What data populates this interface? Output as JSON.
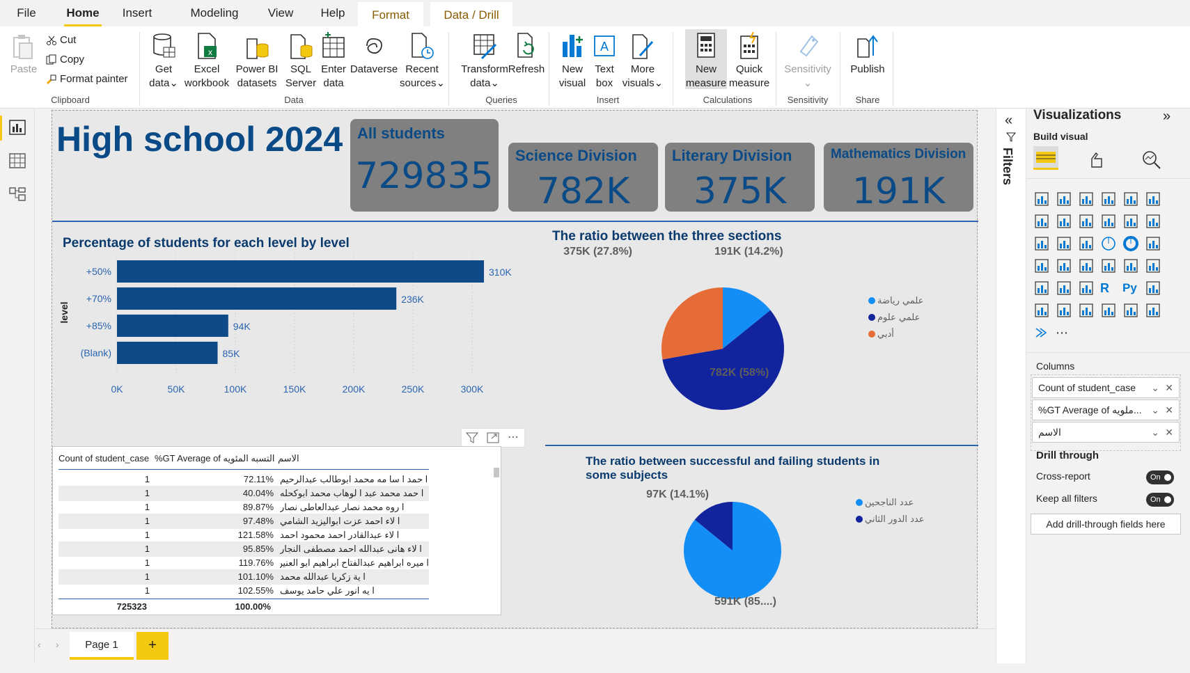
{
  "menu": {
    "items": [
      "File",
      "Home",
      "Insert",
      "Modeling",
      "View",
      "Help"
    ],
    "context_tabs": [
      "Format",
      "Data / Drill"
    ],
    "active": "Home"
  },
  "ribbon": {
    "clipboard": {
      "paste": "Paste",
      "cut": "Cut",
      "copy": "Copy",
      "format_painter": "Format painter",
      "group": "Clipboard"
    },
    "data": {
      "get_data": [
        "Get",
        "data"
      ],
      "excel": [
        "Excel",
        "workbook"
      ],
      "powerbi": [
        "Power BI",
        "datasets"
      ],
      "sql": [
        "SQL",
        "Server"
      ],
      "enter": [
        "Enter",
        "data"
      ],
      "dataverse": "Dataverse",
      "recent": [
        "Recent",
        "sources"
      ],
      "group": "Data"
    },
    "queries": {
      "transform": [
        "Transform",
        "data"
      ],
      "refresh": "Refresh",
      "group": "Queries"
    },
    "insert": {
      "new_visual": [
        "New",
        "visual"
      ],
      "text_box": [
        "Text",
        "box"
      ],
      "more_visuals": [
        "More",
        "visuals"
      ],
      "group": "Insert"
    },
    "calculations": {
      "new_measure": [
        "New",
        "measure"
      ],
      "quick_measure": [
        "Quick",
        "measure"
      ],
      "group": "Calculations"
    },
    "sensitivity": {
      "label": "Sensitivity",
      "group": "Sensitivity"
    },
    "share": {
      "publish": "Publish",
      "group": "Share"
    }
  },
  "report": {
    "title": "High school 2024",
    "cards": [
      {
        "title": "All students",
        "value": "729835"
      },
      {
        "title": "Science Division",
        "value": "782K"
      },
      {
        "title": "Literary Division",
        "value": "375K"
      },
      {
        "title": "Mathematics Division",
        "value": "191K"
      }
    ],
    "bar_title": "Percentage of students for each level by level",
    "pie1_title": "The ratio between the three sections",
    "pie2_title": "The ratio between successful and failing students in some subjects",
    "table": {
      "headers": [
        "Count of student_case",
        "%GT Average of التسبه المئويه",
        "الاسم"
      ],
      "rows": [
        [
          "1",
          "72.11%",
          "ا حمد ا سا مه محمد ابوطالب عبدالرحيم"
        ],
        [
          "1",
          "40.04%",
          "ا حمد محمد عبد ا لوهاب محمد ابوكحله"
        ],
        [
          "1",
          "89.87%",
          "ا روه محمد نصار عبدالعاطى نصار"
        ],
        [
          "1",
          "97.48%",
          "ا لاء احمد عزت ابواليزيد الشامي"
        ],
        [
          "1",
          "121.58%",
          "ا لاء عبدالقادر احمد محمود احمد"
        ],
        [
          "1",
          "95.85%",
          "ا لاء هانى عبدالله احمد مصطفى النجار"
        ],
        [
          "1",
          "119.76%",
          "ا ميره ابراهيم عبدالفتاح ابراهيم ابو العنين"
        ],
        [
          "1",
          "101.10%",
          "ا ية زكريا عبدالله محمد"
        ],
        [
          "1",
          "102.55%",
          "ا يه انور علي حامد يوسف"
        ]
      ],
      "total": [
        "725323",
        "100.00%"
      ]
    }
  },
  "chart_data": [
    {
      "type": "bar",
      "orientation": "horizontal",
      "title": "Percentage of students for each level by level",
      "ylabel": "level",
      "categories": [
        "+50%",
        "+70%",
        "+85%",
        "(Blank)"
      ],
      "values": [
        310000,
        236000,
        94000,
        85000
      ],
      "data_labels": [
        "310K",
        "236K",
        "94K",
        "85K"
      ],
      "xticks": [
        "0K",
        "50K",
        "100K",
        "150K",
        "200K",
        "250K",
        "300K"
      ],
      "xlim": [
        0,
        300000
      ],
      "color": "#0d4a87"
    },
    {
      "type": "pie",
      "title": "The ratio between the three sections",
      "slices": [
        {
          "name": "علمي رياضة",
          "value": 191000,
          "label": "191K (14.2%)",
          "color": "#138ef7"
        },
        {
          "name": "علمي علوم",
          "value": 782000,
          "label": "782K (58%)",
          "color": "#12239e"
        },
        {
          "name": "أدبي",
          "value": 375000,
          "label": "375K (27.8%)",
          "color": "#e66c37"
        }
      ],
      "legend": "right"
    },
    {
      "type": "pie",
      "title": "The ratio between successful and failing students in some subjects",
      "slices": [
        {
          "name": "عدد الناجحين",
          "value": 591000,
          "label": "591K (85....)",
          "color": "#138ef7"
        },
        {
          "name": "عدد الدور الثاني",
          "value": 97000,
          "label": "97K (14.1%)",
          "color": "#12239e"
        }
      ],
      "legend": "right"
    }
  ],
  "filters": {
    "label": "Filters"
  },
  "viz": {
    "title": "Visualizations",
    "build_visual": "Build visual",
    "columns_label": "Columns",
    "wells": [
      "Count of student_case",
      "%GT Average of ملويه...",
      "الاسم"
    ],
    "drill_through": "Drill through",
    "cross_report": "Cross-report",
    "keep_filters": "Keep all filters",
    "toggle_on": "On",
    "add_drill": "Add drill-through fields here"
  },
  "pages": {
    "tab": "Page 1",
    "add": "+"
  },
  "colors": {
    "accent": "#f2c811",
    "title_blue": "#0a4a86",
    "card_bg": "#808080"
  }
}
